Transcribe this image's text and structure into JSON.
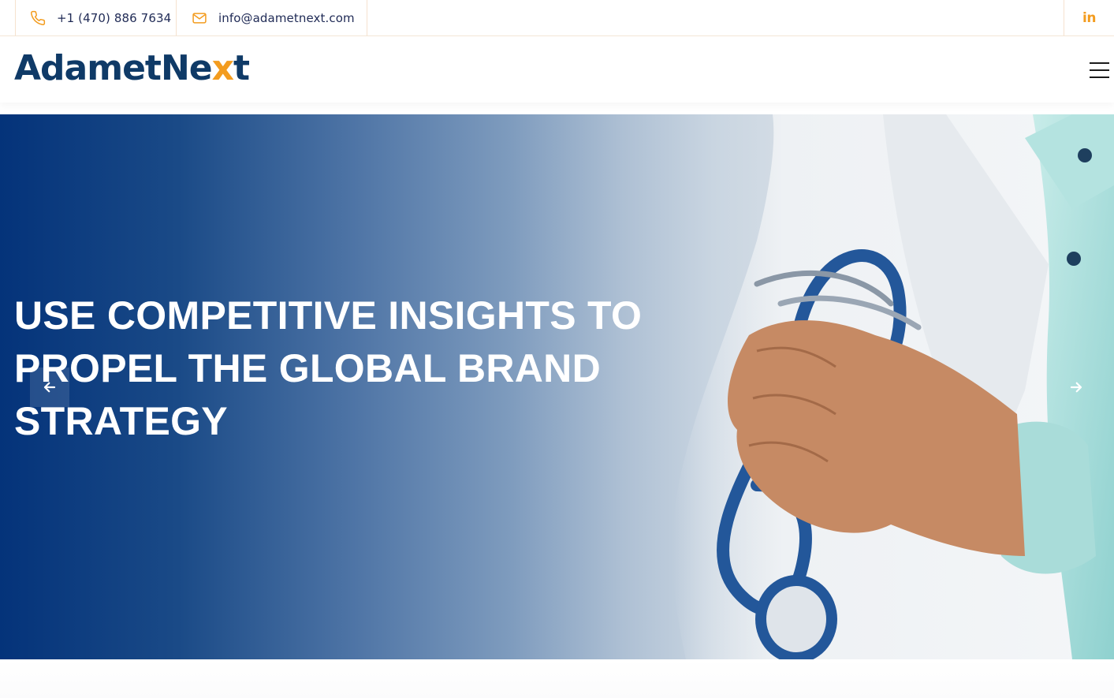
{
  "topbar": {
    "phone": "+1 (470) 886 7634",
    "email": "info@adametnext.com",
    "social": "in",
    "phone_icon": "phone-icon",
    "email_icon": "envelope-icon",
    "social_icon": "linkedin-icon"
  },
  "header": {
    "logo_part1": "Adamet",
    "logo_part2": "Ne",
    "logo_part3": "x",
    "logo_part4": "t",
    "menu_icon": "hamburger-menu-icon"
  },
  "hero": {
    "title": "USE COMPETITIVE INSIGHTS TO PROPEL THE GLOBAL BRAND STRATEGY",
    "prev_icon": "arrow-left-icon",
    "next_icon": "arrow-right-icon"
  },
  "colors": {
    "accent": "#f39c1f",
    "brand": "#0f3a67",
    "hero_start": "#04337a"
  }
}
